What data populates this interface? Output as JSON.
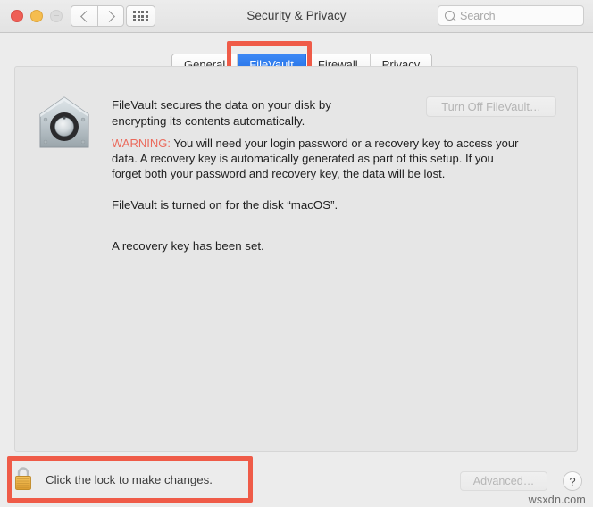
{
  "window": {
    "title": "Security & Privacy",
    "traffic_lights": [
      {
        "name": "close",
        "color": "#ee5f56",
        "enabled": true
      },
      {
        "name": "minimize",
        "color": "#f5bd4f",
        "enabled": true
      },
      {
        "name": "zoom",
        "color": "#dcdcdc",
        "enabled": false
      }
    ],
    "nav": {
      "back_icon": "chevron-left-icon",
      "forward_icon": "chevron-right-icon",
      "show_all_icon": "grid-dots-icon"
    },
    "search": {
      "icon": "search-icon",
      "placeholder": "Search",
      "value": ""
    }
  },
  "tabs": [
    {
      "id": "general",
      "label": "General",
      "selected": false
    },
    {
      "id": "filevault",
      "label": "FileVault",
      "selected": true
    },
    {
      "id": "firewall",
      "label": "Firewall",
      "selected": false
    },
    {
      "id": "privacy",
      "label": "Privacy",
      "selected": false
    }
  ],
  "panel": {
    "icon_name": "filevault-vault-icon",
    "intro": "FileVault secures the data on your disk by encrypting its contents automatically.",
    "warning_label": "WARNING:",
    "warning_text": " You will need your login password or a recovery key to access your data. A recovery key is automatically generated as part of this setup. If you forget both your password and recovery key, the data will be lost.",
    "status_line_1": "FileVault is turned on for the disk “macOS”.",
    "status_line_2": "A recovery key has been set.",
    "turn_off_button": "Turn Off FileVault…"
  },
  "footer": {
    "lock_icon": "lock-closed-icon",
    "lock_message": "Click the lock to make changes.",
    "advanced_button": "Advanced…",
    "help_button": "?",
    "watermark": "wsxdn.com"
  },
  "annotations": {
    "color": "#ef5b48",
    "tab_highlight_target": "filevault",
    "lock_highlight_target": "lock-row"
  }
}
